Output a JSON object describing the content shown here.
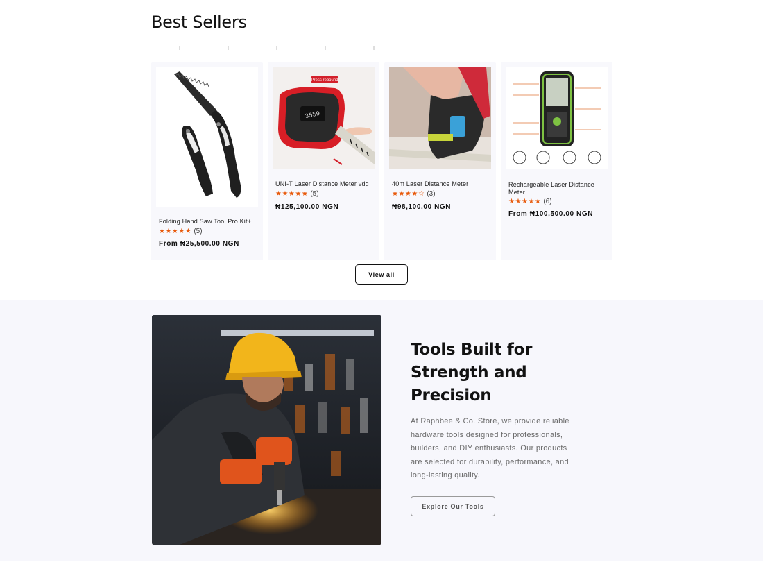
{
  "best_sellers": {
    "title": "Best Sellers",
    "view_all_label": "View all",
    "products": [
      {
        "name": "Folding Hand Saw Tool Pro Kit+",
        "stars": "★★★★★",
        "rating_count": "(5)",
        "price": "From ₦25,500.00 NGN"
      },
      {
        "name": "UNI-T Laser Distance Meter vdg",
        "stars": "★★★★★",
        "rating_count": "(5)",
        "price": "₦125,100.00 NGN",
        "image_badge": "Press rebound"
      },
      {
        "name": "40m Laser Distance Meter",
        "stars": "★★★★☆",
        "rating_count": "(3)",
        "price": "₦98,100.00 NGN"
      },
      {
        "name": "Rechargeable Laser Distance Meter",
        "stars": "★★★★★",
        "rating_count": "(6)",
        "price": "From ₦100,500.00 NGN"
      }
    ]
  },
  "feature": {
    "title": "Tools Built for Strength and Precision",
    "description": "At Raphbee & Co. Store, we provide reliable hardware tools designed for professionals, builders, and DIY enthusiasts. Our products are selected for durability, performance, and long-lasting quality.",
    "cta_label": "Explore Our Tools"
  },
  "colors": {
    "star": "#e85a0c",
    "card_bg": "#f8f8fc",
    "section_bg": "#f7f7fc",
    "text": "#121212"
  }
}
